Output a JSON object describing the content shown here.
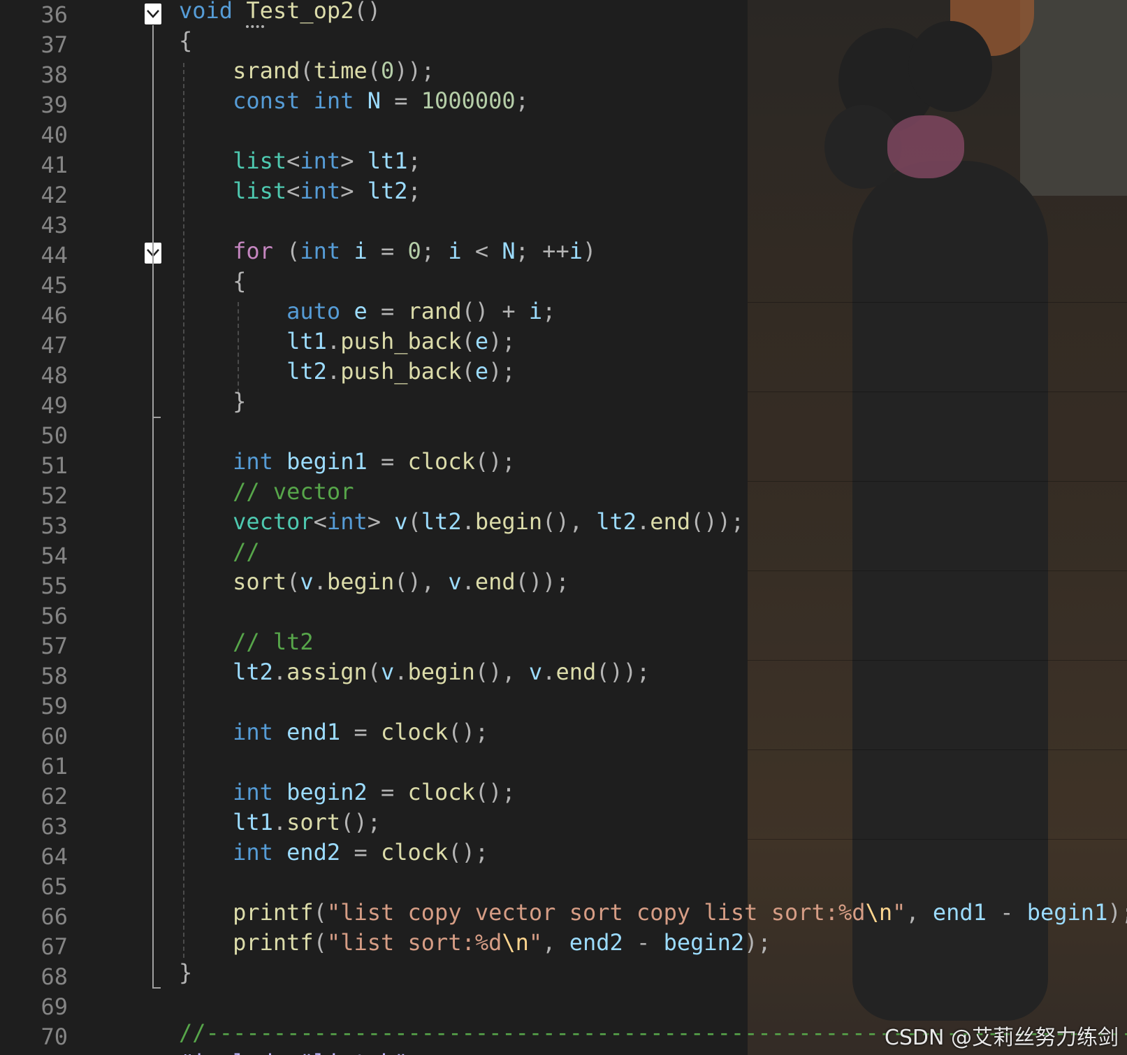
{
  "editor": {
    "line_numbers": [
      "36",
      "37",
      "38",
      "39",
      "40",
      "41",
      "42",
      "43",
      "44",
      "45",
      "46",
      "47",
      "48",
      "49",
      "50",
      "51",
      "52",
      "53",
      "54",
      "55",
      "56",
      "57",
      "58",
      "59",
      "60",
      "61",
      "62",
      "63",
      "64",
      "65",
      "66",
      "67",
      "68",
      "69",
      "70"
    ],
    "fold_icon": "chevron-down-icon",
    "colors": {
      "background": "#1e1e1e",
      "keyword": "#569cd6",
      "control": "#c586c0",
      "type": "#4ec9b0",
      "function": "#dcdcaa",
      "variable": "#9cdcfe",
      "number": "#b5cea8",
      "string": "#d69d85",
      "comment": "#57a64a"
    },
    "code": {
      "l36": [
        "void",
        "Test_op2",
        "()"
      ],
      "l37": [
        "{"
      ],
      "l38": [
        "srand",
        "(",
        "time",
        "(",
        "0",
        "));"
      ],
      "l39": [
        "const",
        "int",
        "N",
        "=",
        "1000000",
        ";"
      ],
      "l41": [
        "list",
        "<",
        "int",
        ">",
        "lt1",
        ";"
      ],
      "l42": [
        "list",
        "<",
        "int",
        ">",
        "lt2",
        ";"
      ],
      "l44": [
        "for",
        "(",
        "int",
        "i",
        "=",
        "0",
        ";",
        "i",
        "<",
        "N",
        ";",
        "++",
        "i",
        ")"
      ],
      "l45": [
        "{"
      ],
      "l46": [
        "auto",
        "e",
        "=",
        "rand",
        "()",
        "+",
        "i",
        ";"
      ],
      "l47": [
        "lt1",
        ".",
        "push_back",
        "(",
        "e",
        ");"
      ],
      "l48": [
        "lt2",
        ".",
        "push_back",
        "(",
        "e",
        ");"
      ],
      "l49": [
        "}"
      ],
      "l51": [
        "int",
        "begin1",
        "=",
        "clock",
        "();"
      ],
      "l52": [
        "// vector"
      ],
      "l53": [
        "vector",
        "<",
        "int",
        ">",
        "v",
        "(",
        "lt2",
        ".",
        "begin",
        "(),",
        "lt2",
        ".",
        "end",
        "());"
      ],
      "l54": [
        "//"
      ],
      "l55": [
        "sort",
        "(",
        "v",
        ".",
        "begin",
        "(),",
        "v",
        ".",
        "end",
        "());"
      ],
      "l57": [
        "// lt2"
      ],
      "l58": [
        "lt2",
        ".",
        "assign",
        "(",
        "v",
        ".",
        "begin",
        "(),",
        "v",
        ".",
        "end",
        "());"
      ],
      "l60": [
        "int",
        "end1",
        "=",
        "clock",
        "();"
      ],
      "l62": [
        "int",
        "begin2",
        "=",
        "clock",
        "();"
      ],
      "l63": [
        "lt1",
        ".",
        "sort",
        "();"
      ],
      "l64": [
        "int",
        "end2",
        "=",
        "clock",
        "();"
      ],
      "l66": [
        "printf",
        "(",
        "\"list copy vector sort copy list sort:%d",
        "\\n",
        "\"",
        ",",
        "end1",
        "-",
        "begin1",
        ");"
      ],
      "l67": [
        "printf",
        "(",
        "\"list sort:%d",
        "\\n",
        "\"",
        ",",
        "end2",
        "-",
        "begin2",
        ");"
      ],
      "l68": [
        "}"
      ],
      "l70": [
        "//------------------------------------------------------------------------------------------------"
      ],
      "l71": [
        "#include \"list.h\""
      ]
    }
  },
  "watermark": "CSDN @艾莉丝努力练剑"
}
